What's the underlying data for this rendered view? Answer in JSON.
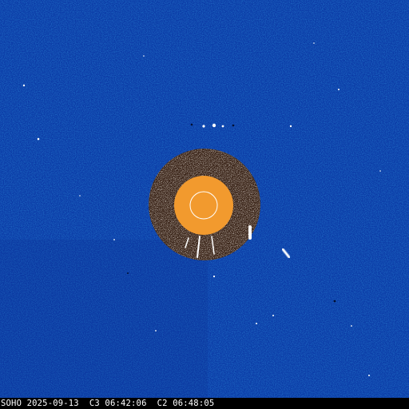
{
  "colors": {
    "sky_background": "#0b3aa6",
    "occulter_ring_dark": "#3a2418",
    "occulter_ring_light": "#e8dccb",
    "occulting_disk": "#f29a2e",
    "sun_outline": "#ffffff",
    "caption_background": "#000000",
    "caption_text": "#ffffff"
  },
  "caption": {
    "text": "SOHO 2025-09-13  C3 06:42:06  C2 06:48:05"
  }
}
